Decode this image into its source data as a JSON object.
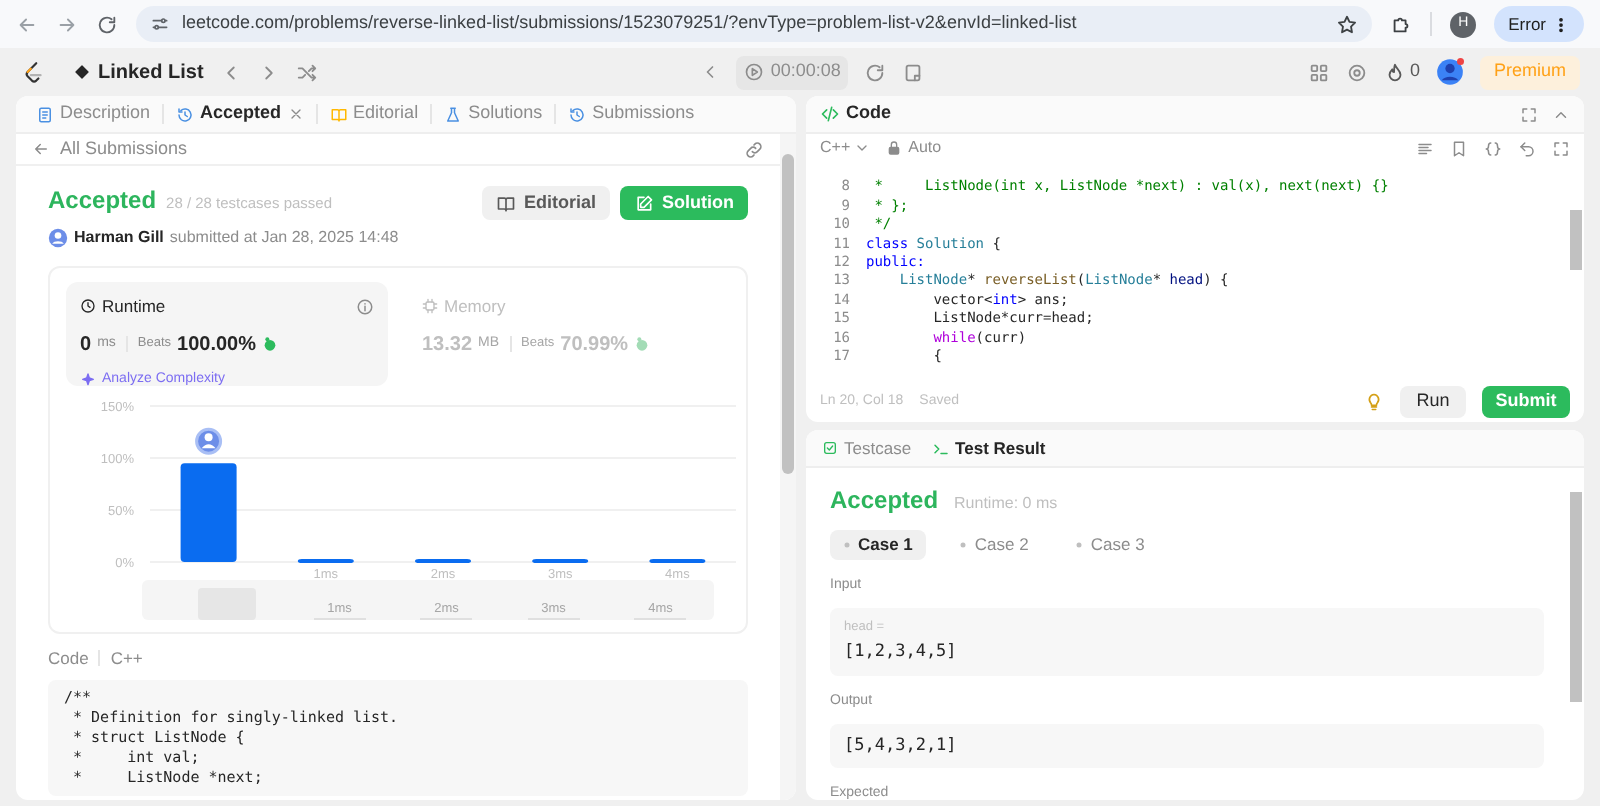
{
  "browser": {
    "url": "leetcode.com/problems/reverse-linked-list/submissions/1523079251/?envType=problem-list-v2&envId=linked-list",
    "profile_initial": "H",
    "error_label": "Error"
  },
  "nav": {
    "problem_list": "Linked List",
    "timer": "00:00:08",
    "streak": "0",
    "premium": "Premium"
  },
  "left_tabs": [
    {
      "label": "Description",
      "selected": false,
      "closable": false
    },
    {
      "label": "Accepted",
      "selected": true,
      "closable": true
    },
    {
      "label": "Editorial",
      "selected": false,
      "closable": false
    },
    {
      "label": "Solutions",
      "selected": false,
      "closable": false
    },
    {
      "label": "Submissions",
      "selected": false,
      "closable": false
    }
  ],
  "submission": {
    "back_label": "All Submissions",
    "status": "Accepted",
    "testcases": "28 / 28 testcases passed",
    "author": "Harman Gill",
    "submitted": "submitted at Jan 28, 2025 14:48",
    "buttons": [
      "Editorial",
      "Solution"
    ],
    "metrics": [
      {
        "label": "Runtime",
        "value": "0",
        "unit": "ms",
        "beats_label": "Beats",
        "beats": "100.00%",
        "selected": true
      },
      {
        "label": "Memory",
        "value": "13.32",
        "unit": "MB",
        "beats_label": "Beats",
        "beats": "70.99%",
        "selected": false
      }
    ],
    "analyze_label": "Analyze Complexity",
    "chart_data": {
      "type": "bar",
      "categories": [
        null,
        "1ms",
        "2ms",
        "3ms",
        "4ms"
      ],
      "series": [
        {
          "color": "#0a6cf0",
          "values": [
            95,
            3,
            3,
            3,
            3
          ]
        }
      ],
      "ylim": [
        0,
        150
      ],
      "yticks": [
        {
          "value": 0,
          "label": "0%"
        },
        {
          "value": 50,
          "label": "50%"
        },
        {
          "value": 100,
          "label": "100%"
        },
        {
          "value": 150,
          "label": "150%"
        }
      ]
    },
    "range_slider": {
      "level": 0.1,
      "labels": [
        "1ms",
        "2ms",
        "3ms",
        "4ms"
      ]
    },
    "code_label": "Code",
    "code_language": "C++",
    "code_lines": [
      "/**",
      " * Definition for singly-linked list.",
      " * struct ListNode {",
      " *     int val;",
      " *     ListNode *next;"
    ]
  },
  "editor": {
    "title": "Code",
    "language": "C++",
    "mode": "Auto",
    "position": "Ln 20, Col 18",
    "save_state": "Saved",
    "run": "Run",
    "submit": "Submit",
    "lines": [
      {
        "n": "8",
        "tokens": [
          {
            "kind": "comment",
            "text": " *     ListNode(int x, ListNode *next) : val(x), next(next) {}"
          }
        ]
      },
      {
        "n": "9",
        "tokens": [
          {
            "kind": "comment",
            "text": " * };"
          }
        ]
      },
      {
        "n": "10",
        "tokens": [
          {
            "kind": "comment",
            "text": " */"
          }
        ]
      },
      {
        "n": "11",
        "tokens": [
          {
            "kind": "keyword",
            "text": "class "
          },
          {
            "kind": "type",
            "text": "Solution"
          },
          {
            "kind": "plain",
            "text": " {"
          }
        ]
      },
      {
        "n": "12",
        "tokens": [
          {
            "kind": "keyword",
            "text": "public:"
          }
        ]
      },
      {
        "n": "13",
        "tokens": [
          {
            "kind": "type",
            "text": "    ListNode"
          },
          {
            "kind": "plain",
            "text": "* "
          },
          {
            "kind": "function",
            "text": "reverseList"
          },
          {
            "kind": "plain",
            "text": "("
          },
          {
            "kind": "type",
            "text": "ListNode"
          },
          {
            "kind": "plain",
            "text": "* "
          },
          {
            "kind": "param",
            "text": "head"
          },
          {
            "kind": "plain",
            "text": ") {"
          }
        ]
      },
      {
        "n": "14",
        "tokens": [
          {
            "kind": "plain",
            "text": "        vector<"
          },
          {
            "kind": "keyword",
            "text": "int"
          },
          {
            "kind": "plain",
            "text": "> ans;"
          }
        ]
      },
      {
        "n": "15",
        "tokens": [
          {
            "kind": "plain",
            "text": "        ListNode*curr=head;"
          }
        ]
      },
      {
        "n": "16",
        "tokens": [
          {
            "kind": "control",
            "text": "        while"
          },
          {
            "kind": "plain",
            "text": "(curr)"
          }
        ]
      },
      {
        "n": "17",
        "tokens": [
          {
            "kind": "plain",
            "text": "        {"
          }
        ]
      }
    ]
  },
  "result_tabs": [
    {
      "label": "Testcase",
      "selected": false
    },
    {
      "label": "Test Result",
      "selected": true
    }
  ],
  "result": {
    "status": "Accepted",
    "runtime": "Runtime: 0 ms",
    "cases": [
      {
        "label": "Case 1",
        "selected": true
      },
      {
        "label": "Case 2",
        "selected": false
      },
      {
        "label": "Case 3",
        "selected": false
      }
    ],
    "sections": [
      {
        "label": "Input",
        "param": "head =",
        "value": "[1,2,3,4,5]"
      },
      {
        "label": "Output",
        "value": "[5,4,3,2,1]"
      },
      {
        "label": "Expected"
      }
    ]
  }
}
